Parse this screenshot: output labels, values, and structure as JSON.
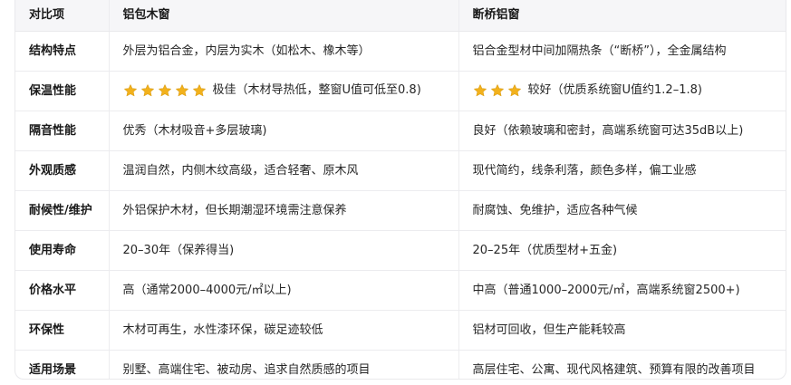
{
  "table": {
    "headers": [
      "对比项",
      "铝包木窗",
      "断桥铝窗"
    ],
    "star_color": "#f2b11c",
    "rows": [
      {
        "label": "结构特点",
        "a": "外层为铝合金，内层为实木（如松木、橡木等）",
        "b": "铝合金型材中间加隔热条（“断桥”），全金属结构"
      },
      {
        "label": "保温性能",
        "a_stars": 5,
        "a": "极佳（木材导热低，整窗U值可低至0.8)",
        "b_stars": 3,
        "b": "较好（优质系统窗U值约1.2–1.8)"
      },
      {
        "label": "隔音性能",
        "a": "优秀（木材吸音+多层玻璃)",
        "b": "良好（依赖玻璃和密封，高端系统窗可达35dB以上)"
      },
      {
        "label": "外观质感",
        "a": "温润自然，内侧木纹高级，适合轻奢、原木风",
        "b": "现代简约，线条利落，颜色多样，偏工业感"
      },
      {
        "label": "耐候性/维护",
        "a": "外铝保护木材，但长期潮湿环境需注意保养",
        "b": "耐腐蚀、免维护，适应各种气候"
      },
      {
        "label": "使用寿命",
        "a": "20–30年（保养得当)",
        "b": "20–25年（优质型材+五金)"
      },
      {
        "label": "价格水平",
        "a": "高（通常2000–4000元/㎡以上)",
        "b": "中高（普通1000–2000元/㎡，高端系统窗2500+)"
      },
      {
        "label": "环保性",
        "a": "木材可再生，水性漆环保，碳足迹较低",
        "b": "铝材可回收，但生产能耗较高"
      },
      {
        "label": "适用场景",
        "a": "别墅、高端住宅、被动房、追求自然质感的项目",
        "b": "高层住宅、公寓、现代风格建筑、预算有限的改善项目"
      }
    ]
  }
}
